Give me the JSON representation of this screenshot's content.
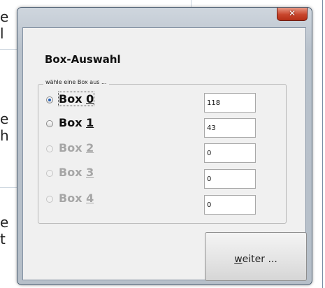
{
  "background": {
    "fragments": [
      "e",
      "l",
      "e",
      "h",
      "e",
      "t"
    ]
  },
  "window": {
    "close_glyph": "✕"
  },
  "dialog": {
    "title": "Box-Auswahl",
    "group_label": "wähle eine Box aus ...",
    "radios": [
      {
        "prefix": "Box ",
        "mnemonic": "0",
        "checked": true,
        "enabled": true,
        "focused": true
      },
      {
        "prefix": "Box ",
        "mnemonic": "1",
        "checked": false,
        "enabled": true,
        "focused": false
      },
      {
        "prefix": "Box ",
        "mnemonic": "2",
        "checked": false,
        "enabled": false,
        "focused": false
      },
      {
        "prefix": "Box ",
        "mnemonic": "3",
        "checked": false,
        "enabled": false,
        "focused": false
      },
      {
        "prefix": "Box ",
        "mnemonic": "4",
        "checked": false,
        "enabled": false,
        "focused": false
      }
    ],
    "values": [
      "118",
      "43",
      "0",
      "0",
      "0"
    ],
    "weiter_button": {
      "mnemonic": "w",
      "rest": "eiter ..."
    }
  }
}
